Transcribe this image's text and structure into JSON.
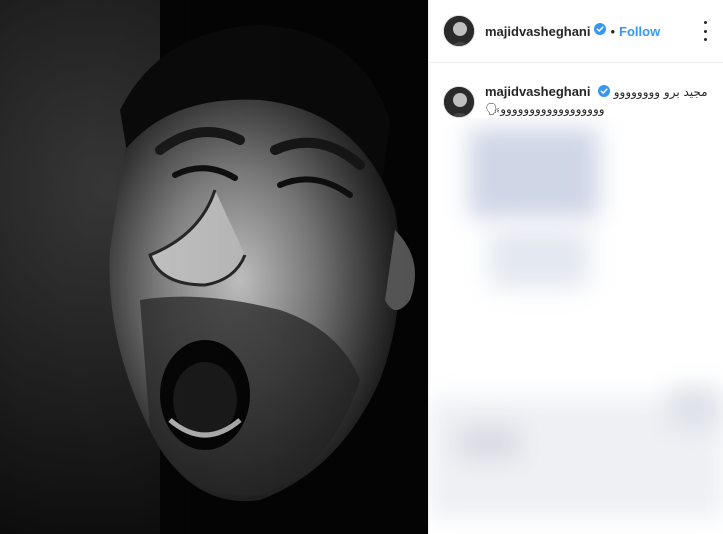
{
  "post": {
    "photo_alt": "Black and white portrait photo"
  },
  "header": {
    "username": "majidvasheghani",
    "separator": "•",
    "follow_label": "Follow"
  },
  "caption": {
    "username": "majidvasheghani",
    "text": "مجید برو وووووووووووووووووووووووووو🗣"
  },
  "icons": {
    "verified": "verified-badge-icon",
    "more": "more-options-icon"
  },
  "colors": {
    "accent": "#3897f0",
    "text": "#262626",
    "divider": "#efefef"
  }
}
